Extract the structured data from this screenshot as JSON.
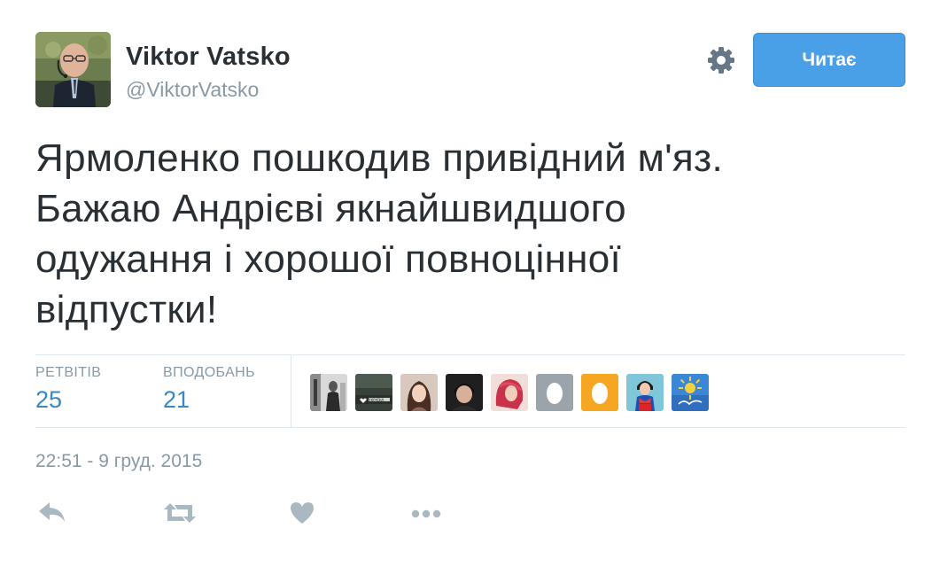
{
  "user": {
    "name": "Viktor Vatsko",
    "handle": "@ViktorVatsko",
    "follow_label": "Читає"
  },
  "tweet": {
    "lines": [
      "Ярмоленко пошкодив привідний м'яз.",
      "Бажаю Андрієві якнайшвидшого",
      "одужання і хорошої повноцінної",
      "відпустки!"
    ],
    "timestamp": "22:51 - 9 груд. 2015"
  },
  "stats": {
    "retweets_label": "РЕТВІТІВ",
    "retweets_count": "25",
    "likes_label": "ВПОДОБАНЬ",
    "likes_count": "21"
  },
  "liked_by": [
    {
      "kind": "photo-bw"
    },
    {
      "kind": "photo-ukraine-banner",
      "text": "УКРАЇНА"
    },
    {
      "kind": "photo-woman"
    },
    {
      "kind": "photo-man-dark"
    },
    {
      "kind": "photo-red-hair"
    },
    {
      "kind": "default-egg",
      "color": "#9aa4aa"
    },
    {
      "kind": "default-egg",
      "color": "#f5a623"
    },
    {
      "kind": "photo-superhero"
    },
    {
      "kind": "photo-sun-logo"
    }
  ],
  "icons": {
    "settings": "gear-icon",
    "reply": "reply-icon",
    "retweet": "retweet-icon",
    "like": "heart-icon",
    "more": "more-icon"
  },
  "colors": {
    "follow_button": "#4aa0e6",
    "stat_value": "#3b88c3",
    "muted": "#8899a6",
    "text": "#292f33",
    "action_icon": "#aab8c2"
  }
}
